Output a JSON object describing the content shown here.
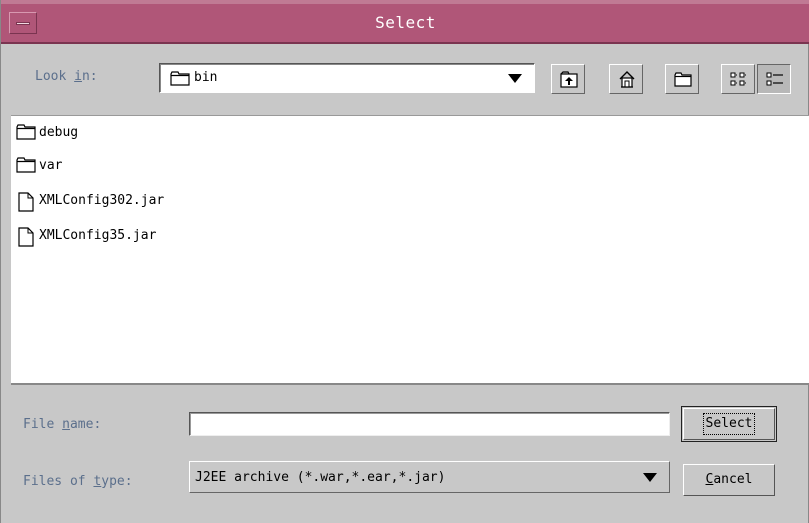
{
  "window": {
    "title": "Select"
  },
  "look_in": {
    "label_pre": "Look ",
    "label_mnemonic": "i",
    "label_post": "n:",
    "value": "bin"
  },
  "toolbar": {
    "buttons": [
      {
        "name": "up-one-level",
        "icon": "up-folder-icon"
      },
      {
        "name": "home",
        "icon": "home-icon"
      },
      {
        "name": "new-folder",
        "icon": "new-folder-icon"
      },
      {
        "name": "list-view",
        "icon": "list-view-icon"
      },
      {
        "name": "details-view",
        "icon": "details-view-icon",
        "pressed": true
      }
    ]
  },
  "files": [
    {
      "name": "debug",
      "type": "folder"
    },
    {
      "name": "var",
      "type": "folder"
    },
    {
      "name": "XMLConfig302.jar",
      "type": "file"
    },
    {
      "name": "XMLConfig35.jar",
      "type": "file"
    }
  ],
  "file_name": {
    "label_pre": "File ",
    "label_mnemonic": "n",
    "label_post": "ame:",
    "value": "",
    "placeholder": ""
  },
  "file_type": {
    "label_pre": "Files of ",
    "label_mnemonic": "t",
    "label_post": "ype:",
    "value": "J2EE archive (*.war,*.ear,*.jar)"
  },
  "buttons": {
    "select_label": "Select",
    "cancel_mnemonic": "C",
    "cancel_rest": "ancel"
  },
  "colors": {
    "titlebar": "#b05678",
    "label_text": "#5b6f8c",
    "background": "#c8c8c8"
  }
}
